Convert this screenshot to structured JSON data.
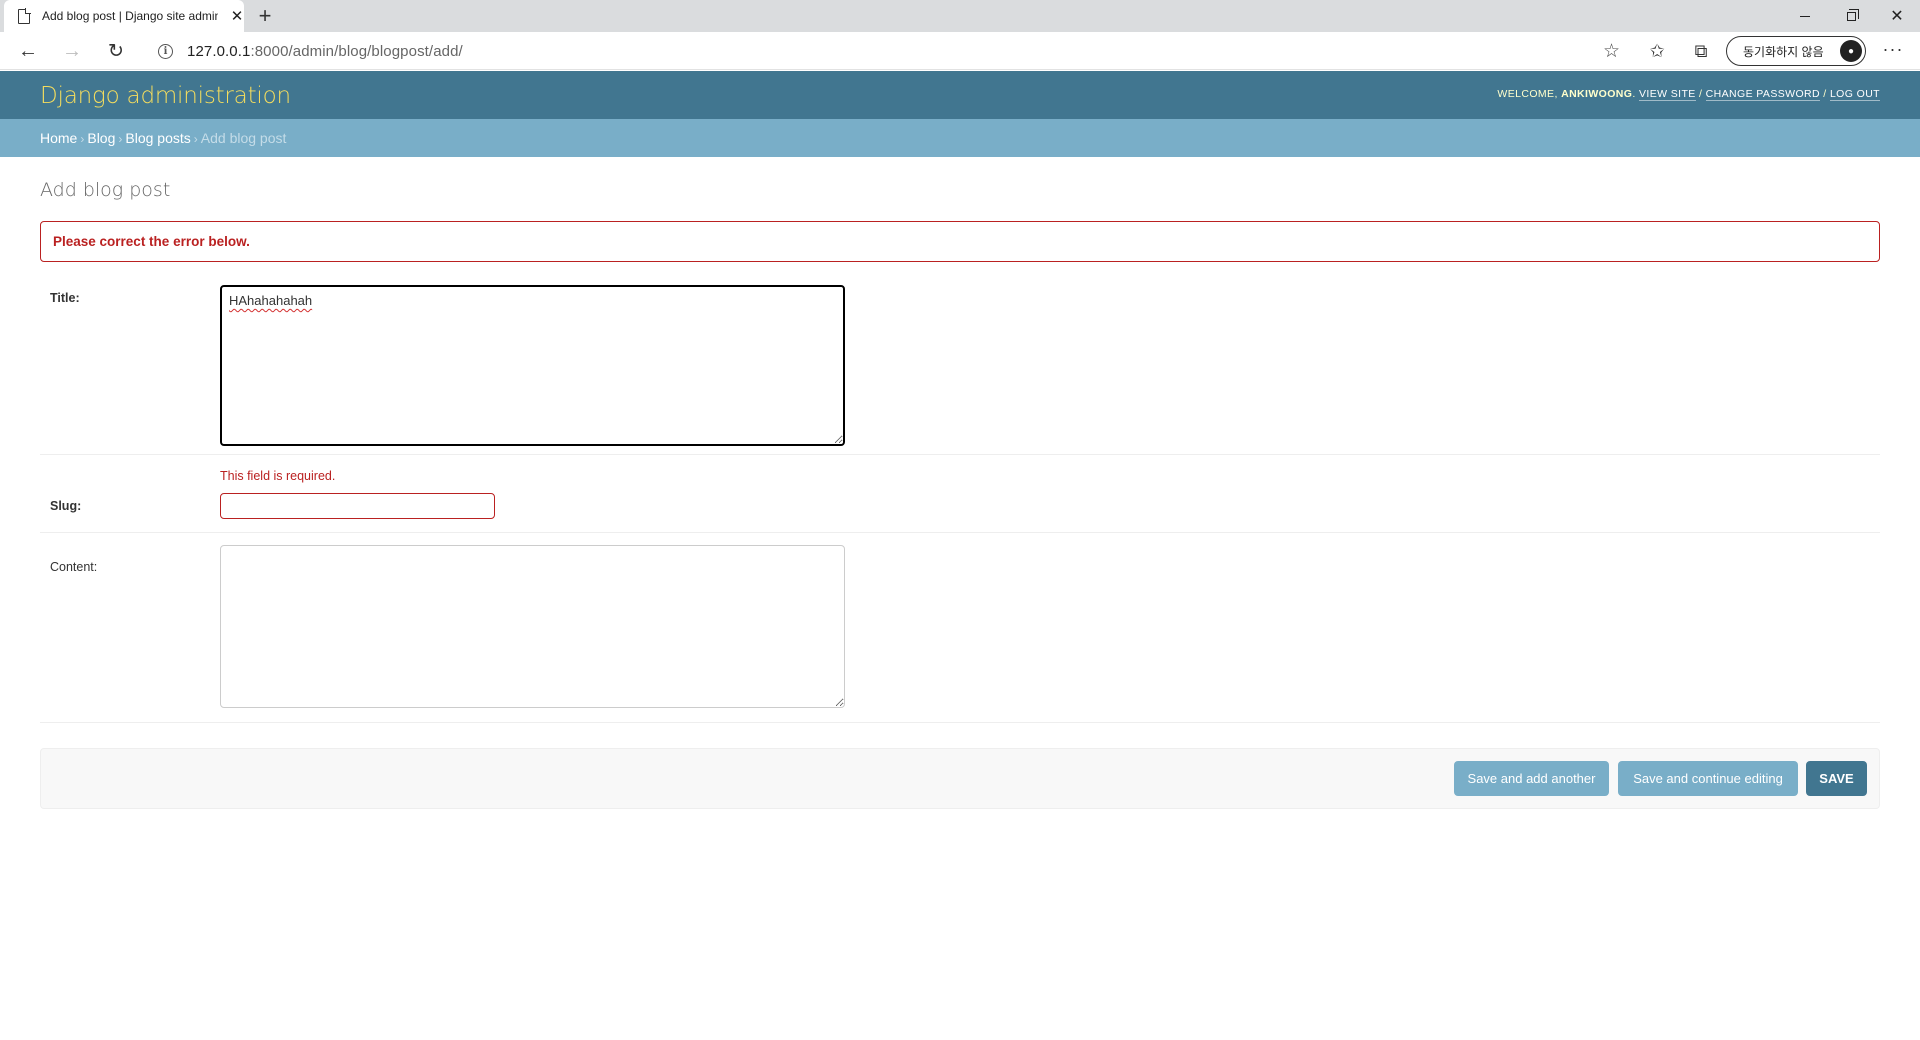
{
  "browser": {
    "tab_title": "Add blog post | Django site admin",
    "tab_close": "✕",
    "new_tab": "+",
    "url_host": "127.0.0.1",
    "url_rest": ":8000/admin/blog/blogpost/add/",
    "sync_label": "동기화하지 않음",
    "icons": {
      "back": "back-arrow-icon",
      "forward": "forward-arrow-icon",
      "refresh": "refresh-icon",
      "info": "info-icon",
      "favorite": "star-icon",
      "favorites": "favorites-icon",
      "collections": "collections-icon",
      "more": "more-icon"
    }
  },
  "admin": {
    "brand": "Django administration",
    "user_tools": {
      "welcome": "Welcome,",
      "username": "ankiwoong",
      "view_site": "View site",
      "change_password": "Change password",
      "log_out": "Log out"
    },
    "breadcrumbs": {
      "home": "Home",
      "app": "Blog",
      "model": "Blog posts",
      "current": "Add blog post"
    },
    "page_title": "Add blog post",
    "error_note": "Please correct the error below.",
    "form": {
      "title": {
        "label": "Title:",
        "value": "HAhahahahah"
      },
      "slug": {
        "label": "Slug:",
        "value": "",
        "error": "This field is required."
      },
      "content": {
        "label": "Content:",
        "value": ""
      }
    },
    "buttons": {
      "save_add_another": "Save and add another",
      "save_continue": "Save and continue editing",
      "save": "Save"
    },
    "colors": {
      "header_bg": "#417690",
      "brand_text": "#f5dd5d",
      "breadcrumb_bg": "#79aec8",
      "error": "#ba2121"
    }
  }
}
